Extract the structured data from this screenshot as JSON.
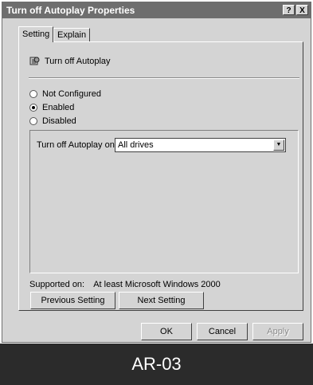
{
  "window": {
    "title": "Turn off Autoplay Properties",
    "help_glyph": "?",
    "close_glyph": "X"
  },
  "tabs": [
    {
      "label": "Setting"
    },
    {
      "label": "Explain"
    }
  ],
  "setting": {
    "policy_title": "Turn off Autoplay",
    "radios": [
      {
        "label": "Not Configured",
        "selected": false
      },
      {
        "label": "Enabled",
        "selected": true
      },
      {
        "label": "Disabled",
        "selected": false
      }
    ],
    "option_label": "Turn off Autoplay on:",
    "option_value": "All drives",
    "supported_label": "Supported on:",
    "supported_value": "At least Microsoft Windows 2000",
    "prev_button": "Previous Setting",
    "next_button": "Next Setting"
  },
  "footer": {
    "ok": "OK",
    "cancel": "Cancel",
    "apply": "Apply"
  },
  "caption": "AR-03",
  "icons": {
    "policy": "gear-policy-icon",
    "dropdown": "chevron-down-icon"
  }
}
